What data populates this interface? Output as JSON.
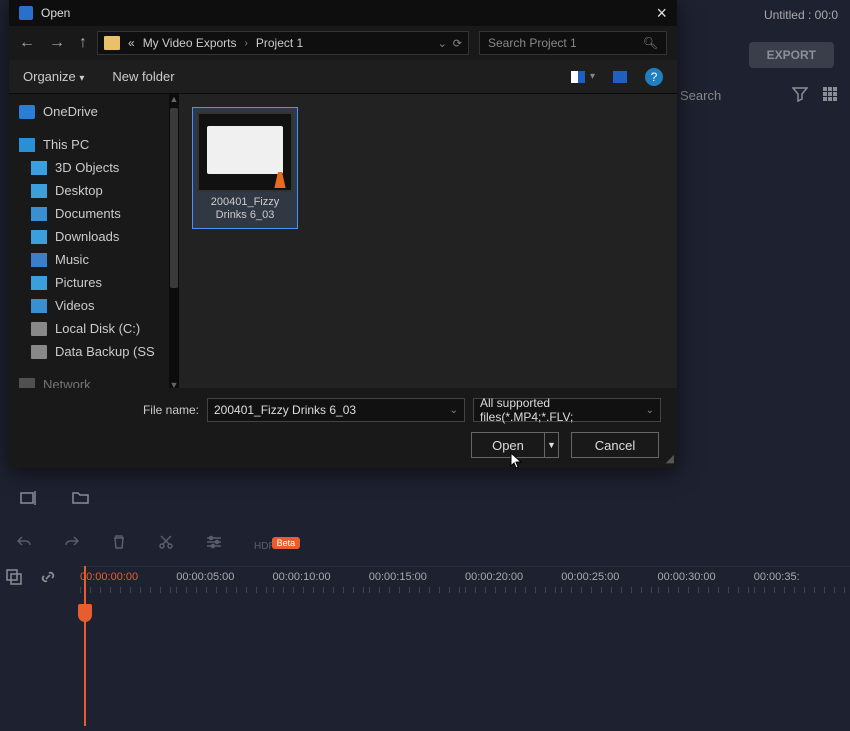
{
  "app": {
    "title_status": "Untitled : 00:0",
    "export_label": "EXPORT",
    "search_placeholder": "Search"
  },
  "tools": {
    "hdr": "HDR",
    "badge": "Beta"
  },
  "timeline": {
    "ticks": [
      "00:00:00:00",
      "00:00:05:00",
      "00:00:10:00",
      "00:00:15:00",
      "00:00:20:00",
      "00:00:25:00",
      "00:00:30:00",
      "00:00:35:"
    ]
  },
  "dialog": {
    "title": "Open",
    "nav": {
      "prefix": "«",
      "crumb1": "My Video Exports",
      "crumb2": "Project 1"
    },
    "search_placeholder": "Search Project 1",
    "organize": "Organize",
    "new_folder": "New folder",
    "tree": {
      "onedrive": "OneDrive",
      "this_pc": "This PC",
      "d3": "3D Objects",
      "desktop": "Desktop",
      "documents": "Documents",
      "downloads": "Downloads",
      "music": "Music",
      "pictures": "Pictures",
      "videos": "Videos",
      "local_disk": "Local Disk (C:)",
      "data_backup": "Data Backup (SS",
      "network": "Network"
    },
    "file": {
      "name": "200401_Fizzy Drinks 6_03"
    },
    "filename_label": "File name:",
    "filename_value": "200401_Fizzy Drinks 6_03",
    "filetype": "All supported files(*.MP4;*.FLV;",
    "open": "Open",
    "cancel": "Cancel"
  }
}
